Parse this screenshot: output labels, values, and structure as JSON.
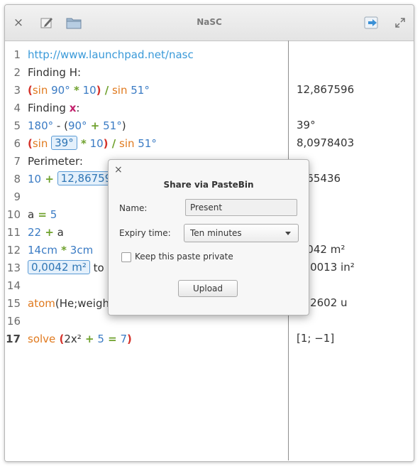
{
  "window": {
    "title": "NaSC"
  },
  "editor": {
    "lines": [
      {
        "n": "1",
        "t": [
          "http://www.launchpad.net/nasc"
        ]
      },
      {
        "n": "2",
        "t": [
          "Finding H:"
        ]
      },
      {
        "n": "3",
        "t": [
          "(",
          "sin",
          " 90°",
          " *",
          " 10",
          ")",
          " /",
          " sin",
          " 51°"
        ]
      },
      {
        "n": "4",
        "t": [
          "Finding ",
          "x",
          ":"
        ]
      },
      {
        "n": "5",
        "t": [
          "180°",
          " -",
          " (",
          "90°",
          " +",
          " 51°",
          ")"
        ]
      },
      {
        "n": "6",
        "t": [
          "(",
          "sin",
          "39°",
          " *",
          " 10",
          ")",
          " /",
          " sin",
          " 51°"
        ]
      },
      {
        "n": "7",
        "t": [
          "Perimeter:"
        ]
      },
      {
        "n": "8",
        "t": [
          "10",
          " +",
          "12,86759"
        ]
      },
      {
        "n": "9",
        "t": []
      },
      {
        "n": "10",
        "t": [
          "a",
          " =",
          " 5"
        ]
      },
      {
        "n": "11",
        "t": [
          "22",
          " +",
          " a"
        ]
      },
      {
        "n": "12",
        "t": [
          "14cm",
          " *",
          " 3cm"
        ]
      },
      {
        "n": "13",
        "t": [
          "0,0042 m²",
          " to"
        ]
      },
      {
        "n": "14",
        "t": []
      },
      {
        "n": "15",
        "t": [
          "atom",
          "(He;weight)"
        ]
      },
      {
        "n": "16",
        "t": []
      },
      {
        "n": "17",
        "t": [
          "solve",
          " (",
          "2x²",
          " +",
          " 5",
          " =",
          " 7",
          ")"
        ]
      }
    ]
  },
  "results": {
    "r3": "12,867596",
    "r5": "39°",
    "r6": "8,0978403",
    "r8": ",965436",
    "r11": "7",
    "r12": ",0042 m²",
    "r13": "510013 in²",
    "r15": "002602 u",
    "r17": "[1; −1]"
  },
  "dialog": {
    "title": "Share via PasteBin",
    "name_label": "Name:",
    "name_value": "Present",
    "expiry_label": "Expiry time:",
    "expiry_value": "Ten minutes",
    "private_label": "Keep this paste private",
    "upload_label": "Upload",
    "close_glyph": "×"
  },
  "toolbar": {
    "close_glyph": "×"
  }
}
